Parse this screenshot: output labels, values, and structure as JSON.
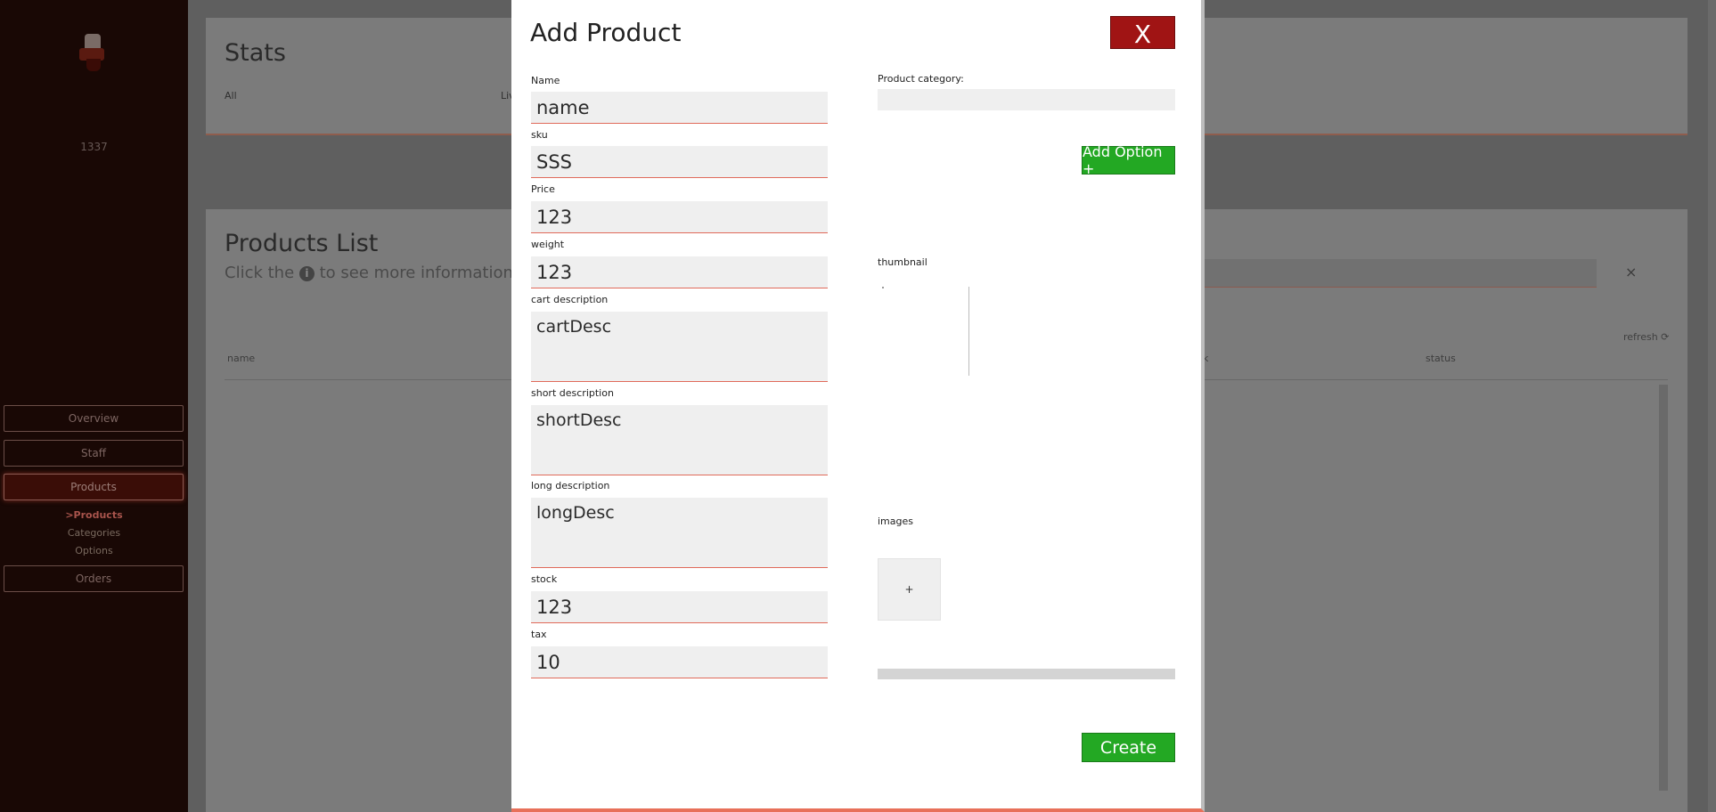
{
  "sidebar": {
    "user_number": "1337",
    "nav": [
      {
        "label": "Overview"
      },
      {
        "label": "Staff"
      },
      {
        "label": "Products"
      },
      {
        "label": "Orders"
      }
    ],
    "subnav": [
      {
        "label": ">Products"
      },
      {
        "label": "Categories"
      },
      {
        "label": "Options"
      }
    ]
  },
  "stats": {
    "title": "Stats",
    "tab_all": "All",
    "tab_live": "Liv"
  },
  "products_list": {
    "title": "Products List",
    "subtitle_before": "Click the",
    "info_glyph": "i",
    "subtitle_after": "to see more information",
    "clear_glyph": "×",
    "refresh_label": "refresh ⟳",
    "columns": {
      "name": "name",
      "stock": "k",
      "status": "status"
    }
  },
  "modal": {
    "title": "Add Product",
    "close_label": "X",
    "fields": {
      "name": {
        "label": "Name",
        "value": "name"
      },
      "sku": {
        "label": "sku",
        "value": "SSS"
      },
      "price": {
        "label": "Price",
        "value": "123"
      },
      "weight": {
        "label": "weight",
        "value": "123"
      },
      "cart_description": {
        "label": "cart description",
        "value": "cartDesc"
      },
      "short_description": {
        "label": "short description",
        "value": "shortDesc"
      },
      "long_description": {
        "label": "long description",
        "value": "longDesc"
      },
      "stock": {
        "label": "stock",
        "value": "123"
      },
      "tax": {
        "label": "tax",
        "value": "10"
      }
    },
    "category_label": "Product category:",
    "category_value": "",
    "add_option_label": "Add Option +",
    "thumbnail_label": "thumbnail",
    "images_label": "images",
    "add_image_label": "+",
    "upload_progress": 0,
    "create_label": "Create"
  },
  "colors": {
    "accent_green": "#23a823",
    "close_red": "#a01414",
    "input_underline": "#e06a5a",
    "sidebar_bg": "#190805"
  }
}
